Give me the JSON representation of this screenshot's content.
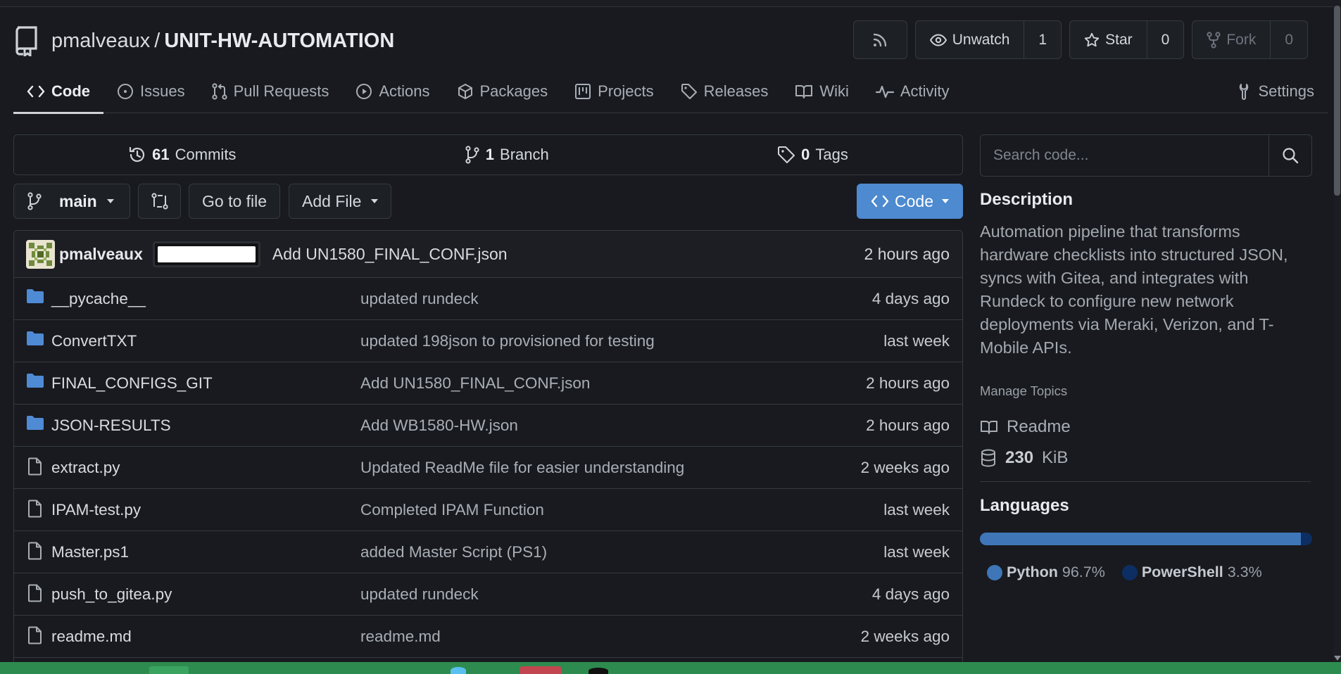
{
  "repo": {
    "owner": "pmalveaux",
    "separator": "/",
    "name": "UNIT-HW-AUTOMATION"
  },
  "header_actions": {
    "unwatch_label": "Unwatch",
    "watch_count": "1",
    "star_label": "Star",
    "star_count": "0",
    "fork_label": "Fork",
    "fork_count": "0"
  },
  "tabs": [
    {
      "label": "Code",
      "icon": "code-icon",
      "active": true
    },
    {
      "label": "Issues",
      "icon": "issue-icon"
    },
    {
      "label": "Pull Requests",
      "icon": "pull-request-icon"
    },
    {
      "label": "Actions",
      "icon": "play-icon"
    },
    {
      "label": "Packages",
      "icon": "package-icon"
    },
    {
      "label": "Projects",
      "icon": "project-icon"
    },
    {
      "label": "Releases",
      "icon": "tag-icon"
    },
    {
      "label": "Wiki",
      "icon": "book-icon"
    },
    {
      "label": "Activity",
      "icon": "pulse-icon"
    },
    {
      "label": "Settings",
      "icon": "tool-icon"
    }
  ],
  "stats": {
    "commits_count": "61",
    "commits_label": "Commits",
    "branch_count": "1",
    "branch_label": "Branch",
    "tags_count": "0",
    "tags_label": "Tags"
  },
  "toolbar": {
    "branch": "main",
    "go_to_file": "Go to file",
    "add_file": "Add File",
    "code": "Code"
  },
  "latest_commit": {
    "author": "pmalveaux",
    "message": "Add UN1580_FINAL_CONF.json",
    "time": "2 hours ago"
  },
  "files": [
    {
      "type": "folder",
      "name": "__pycache__",
      "message": "updated rundeck",
      "time": "4 days ago"
    },
    {
      "type": "folder",
      "name": "ConvertTXT",
      "message": "updated 198json to provisioned for testing",
      "time": "last week"
    },
    {
      "type": "folder",
      "name": "FINAL_CONFIGS_GIT",
      "message": "Add UN1580_FINAL_CONF.json",
      "time": "2 hours ago"
    },
    {
      "type": "folder",
      "name": "JSON-RESULTS",
      "message": "Add WB1580-HW.json",
      "time": "2 hours ago"
    },
    {
      "type": "file",
      "name": "extract.py",
      "message": "Updated ReadMe file for easier understanding",
      "time": "2 weeks ago"
    },
    {
      "type": "file",
      "name": "IPAM-test.py",
      "message": "Completed IPAM Function",
      "time": "last week"
    },
    {
      "type": "file",
      "name": "Master.ps1",
      "message": "added Master Script (PS1)",
      "time": "last week"
    },
    {
      "type": "file",
      "name": "push_to_gitea.py",
      "message": "updated rundeck",
      "time": "4 days ago"
    },
    {
      "type": "file",
      "name": "readme.md",
      "message": "readme.md",
      "time": "2 weeks ago"
    }
  ],
  "sidebar": {
    "search_placeholder": "Search code...",
    "description_heading": "Description",
    "description": "Automation pipeline that transforms hardware checklists into structured JSON, syncs with Gitea, and integrates with Rundeck to configure new network deployments via Meraki, Verizon, and T-Mobile APIs.",
    "manage_topics": "Manage Topics",
    "readme": "Readme",
    "size_value": "230",
    "size_unit": "KiB",
    "languages_heading": "Languages",
    "languages": [
      {
        "name": "Python",
        "percent": "96.7%",
        "fraction": 0.967,
        "color": "#3f76b8"
      },
      {
        "name": "PowerShell",
        "percent": "3.3%",
        "fraction": 0.033,
        "color": "#0d2e62"
      }
    ]
  },
  "colors": {
    "accent_button": "#4d8ad0",
    "background": "#181a1f",
    "folder": "#4f8ad4"
  }
}
